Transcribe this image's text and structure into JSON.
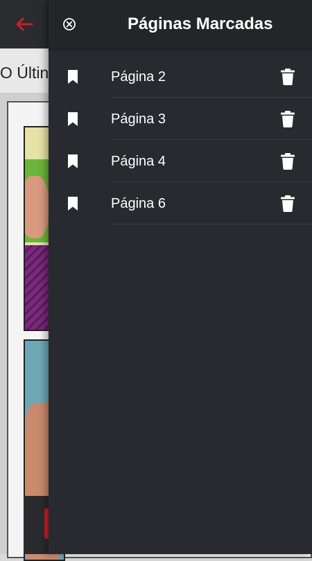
{
  "background": {
    "back_icon": "arrow-left-icon",
    "title_fragment": "O Últin"
  },
  "drawer": {
    "title": "Páginas Marcadas",
    "close_icon": "close-circle-icon",
    "items": [
      {
        "label": "Página 2",
        "icon": "bookmark-icon",
        "action_icon": "trash-icon"
      },
      {
        "label": "Página 3",
        "icon": "bookmark-icon",
        "action_icon": "trash-icon"
      },
      {
        "label": "Página 4",
        "icon": "bookmark-icon",
        "action_icon": "trash-icon"
      },
      {
        "label": "Página 6",
        "icon": "bookmark-icon",
        "action_icon": "trash-icon"
      }
    ]
  },
  "colors": {
    "drawer_bg": "#282a2f",
    "accent": "#c8202a",
    "text": "#ffffff"
  }
}
